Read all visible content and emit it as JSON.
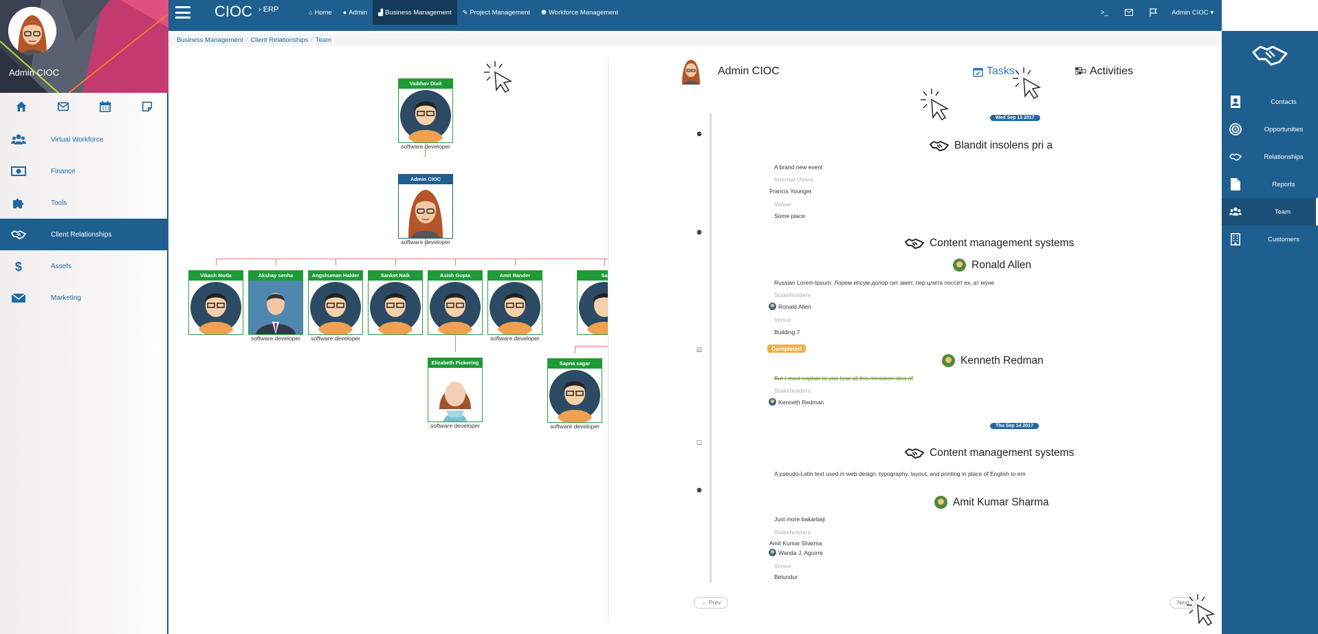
{
  "profile": {
    "name": "Admin CIOC"
  },
  "quick_icons": [
    "home-icon",
    "envelope-icon",
    "calendar-icon",
    "note-icon"
  ],
  "left_nav": [
    {
      "label": "Virtual Workforce",
      "icon": "users-icon"
    },
    {
      "label": "Finance",
      "icon": "money-icon"
    },
    {
      "label": "Tools",
      "icon": "puzzle-icon"
    },
    {
      "label": "Client Relationships",
      "icon": "handshake-icon",
      "active": true
    },
    {
      "label": "Assets",
      "icon": "dollar-icon"
    },
    {
      "label": "Marketing",
      "icon": "envelope-icon"
    }
  ],
  "brand": {
    "name": "CIOC",
    "sub": "› ERP"
  },
  "top_nav": [
    {
      "label": "Home",
      "icon": "home-icon"
    },
    {
      "label": "Admin",
      "icon": "user-icon"
    },
    {
      "label": "Business Management",
      "icon": "industry-icon",
      "active": true
    },
    {
      "label": "Project Management",
      "icon": "wrench-icon"
    },
    {
      "label": "Workforce Management",
      "icon": "users-icon"
    }
  ],
  "top_right": {
    "user_menu": "Admin CIOC ▾"
  },
  "breadcrumb": [
    "Business Management",
    "Client Relationships",
    "Team"
  ],
  "org": {
    "top": {
      "name": "Vaibhav Dixit",
      "role": "software developer"
    },
    "middle": {
      "name": "Admin CIOC",
      "role": "software developer"
    },
    "children": [
      {
        "name": "Vikash Motla",
        "role": ""
      },
      {
        "name": "Akshay senha",
        "role": "software developer"
      },
      {
        "name": "Angshuman Halder",
        "role": "software developer"
      },
      {
        "name": "Sanket Naik",
        "role": ""
      },
      {
        "name": "Asish Gupta",
        "role": ""
      },
      {
        "name": "Amit Rander",
        "role": "software developer"
      },
      {
        "name": "Sa",
        "role": ""
      }
    ],
    "grandchildren": [
      {
        "name": "Elizabeth Pickering",
        "role": "software developer"
      },
      {
        "name": "Sapna sagar",
        "role": "software developer"
      }
    ]
  },
  "activity_header": {
    "name": "Admin CIOC",
    "tab_tasks": "Tasks",
    "tab_activities": "Activities"
  },
  "timeline": {
    "date1": "Wed Sep 13 2017",
    "date2": "Thu Sep 14 2017",
    "ev1": {
      "title": "Blandit insolens pri a",
      "desc": "A brand new event",
      "label_users": "Internal Users",
      "user": "Francis Younger",
      "label_venue": "Venue",
      "venue": "Some place"
    },
    "ev2": {
      "title": "Content management systems",
      "person": "Ronald Allen",
      "desc": "Russian Lorem Ipsum: Лорем ипсум долор сит амет, пер цлита поссит ех, ат муне",
      "label_stake": "Stakeholders",
      "stakeholder": "Ronald Allen",
      "label_venue": "Venue",
      "venue": "Building 7"
    },
    "ev3": {
      "badge": "Completed",
      "person": "Kenneth Redman",
      "desc": "But I must explain to you how all this mistaken idea of",
      "label_stake": "Stakeholders",
      "stakeholder": "Kenneth Redman"
    },
    "ev4": {
      "title": "Content management systems",
      "desc": "A pseudo-Latin text used in web design, typography, layout, and printing in place of English to em"
    },
    "ev5": {
      "person": "Amit Kumar Sharma",
      "desc": "Just more bakarbaji",
      "label_stake": "Stakeholders",
      "stake1": "Amit Kumar Sharma",
      "stake2": "Wanda J. Aguirre",
      "label_venue": "Venue",
      "venue": "Belundur"
    }
  },
  "pager": {
    "prev": "← Prev",
    "next": "Next"
  },
  "right_nav": [
    {
      "label": "Contacts",
      "icon": "address-book-icon"
    },
    {
      "label": "Opportunities",
      "icon": "bullseye-icon"
    },
    {
      "label": "Relationships",
      "icon": "handshake-icon"
    },
    {
      "label": "Reports",
      "icon": "file-icon"
    },
    {
      "label": "Team",
      "icon": "users-icon",
      "active": true
    },
    {
      "label": "Customers",
      "icon": "building-icon"
    }
  ],
  "colors": {
    "primary": "#1e5f8f",
    "dark": "#14395a",
    "org_green": "#1e9a37",
    "org_line": "#e07a7a",
    "badge_orange": "#f0ad4e"
  }
}
